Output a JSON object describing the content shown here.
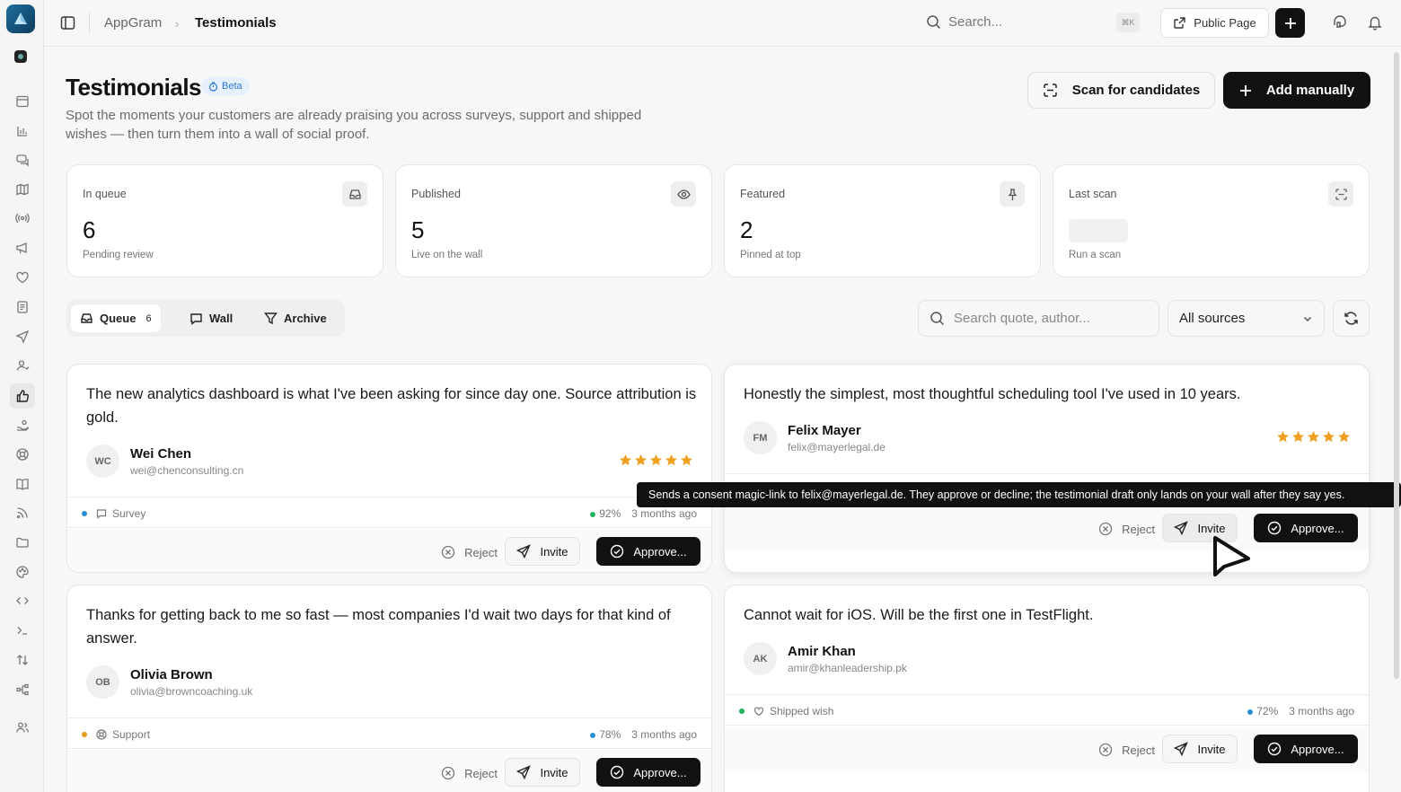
{
  "breadcrumb": {
    "app": "AppGram",
    "current": "Testimonials"
  },
  "topbar": {
    "search_placeholder": "Search...",
    "shortcut": "⌘K",
    "public_page_label": "Public Page"
  },
  "header": {
    "title": "Testimonials",
    "badge": "Beta",
    "subtitle": "Spot the moments your customers are already praising you across surveys, support and shipped wishes — then turn them into a wall of social proof.",
    "scan_label": "Scan for candidates",
    "add_label": "Add manually"
  },
  "stats": [
    {
      "label": "In queue",
      "value": "6",
      "caption": "Pending review",
      "icon": "inbox-icon"
    },
    {
      "label": "Published",
      "value": "5",
      "caption": "Live on the wall",
      "icon": "eye-icon"
    },
    {
      "label": "Featured",
      "value": "2",
      "caption": "Pinned at top",
      "icon": "pin-icon"
    },
    {
      "label": "Last scan",
      "value": "",
      "caption": "Run a scan",
      "icon": "scan-icon"
    }
  ],
  "tabs": [
    {
      "label": "Queue",
      "count": "6",
      "active": true
    },
    {
      "label": "Wall"
    },
    {
      "label": "Archive"
    }
  ],
  "filters": {
    "search_placeholder": "Search quote, author...",
    "source_selected": "All sources"
  },
  "actions": {
    "reject": "Reject",
    "invite": "Invite",
    "approve": "Approve..."
  },
  "cards": [
    {
      "quote": "The new analytics dashboard is what I've been asking for since day one. Source attribution is gold.",
      "initials": "WC",
      "name": "Wei Chen",
      "email": "wei@chenconsulting.cn",
      "stars": 5,
      "source": "Survey",
      "source_color": "#2b8fd6",
      "score": "92%",
      "score_color": "#22b35e",
      "time": "3 months ago"
    },
    {
      "quote": "Honestly the simplest, most thoughtful scheduling tool I've used in 10 years.",
      "initials": "FM",
      "name": "Felix Mayer",
      "email": "felix@mayerlegal.de",
      "stars": 5
    },
    {
      "quote": "Thanks for getting back to me so fast — most companies I'd wait two days for that kind of answer.",
      "initials": "OB",
      "name": "Olivia Brown",
      "email": "olivia@browncoaching.uk",
      "source": "Support",
      "source_color": "#e89a1c",
      "score": "78%",
      "score_color": "#2b8fd6",
      "time": "3 months ago"
    },
    {
      "quote": "Cannot wait for iOS. Will be the first one in TestFlight.",
      "initials": "AK",
      "name": "Amir Khan",
      "email": "amir@khanleadership.pk",
      "source": "Shipped wish",
      "source_color": "#22b35e",
      "score": "72%",
      "score_color": "#2b8fd6",
      "time": "3 months ago"
    }
  ],
  "tooltip": "Sends a consent magic-link to felix@mayerlegal.de. They approve or decline; the testimonial draft only lands on your wall after they say yes.",
  "colors": {
    "star": "#f0a020",
    "primary": "#111111",
    "beta_bg": "#e6f1fd",
    "beta_fg": "#2b78d0"
  }
}
